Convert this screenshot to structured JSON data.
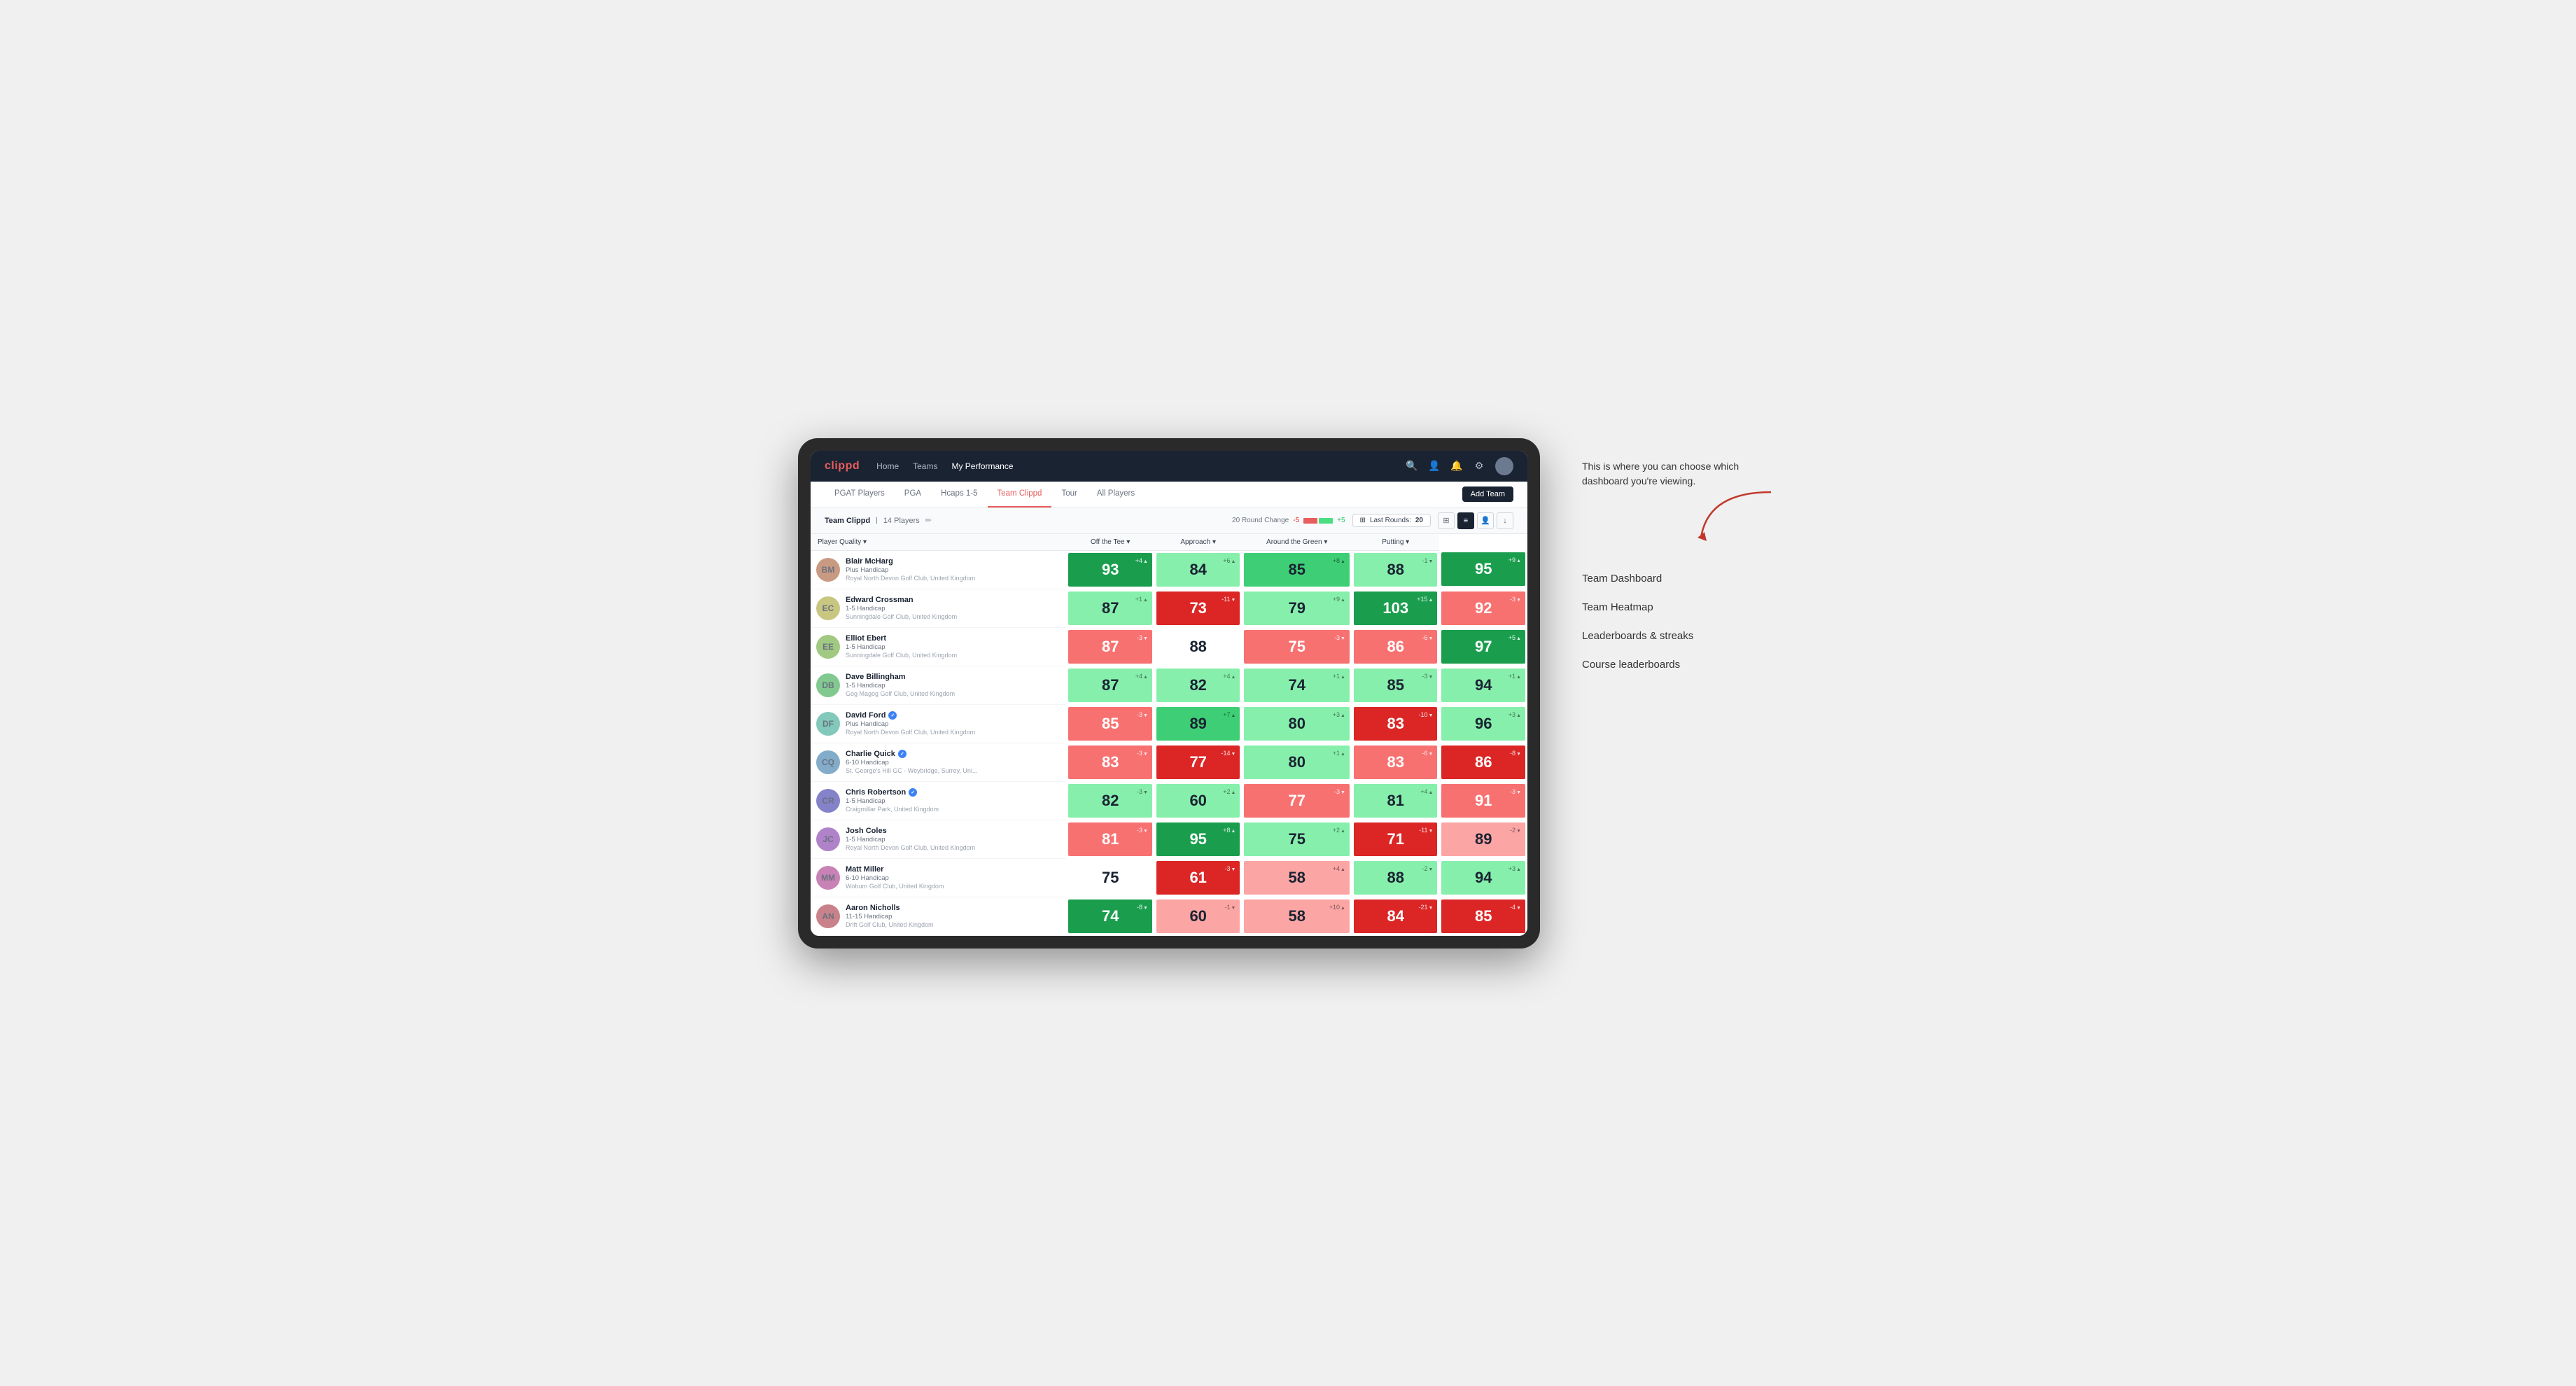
{
  "annotation": {
    "note": "This is where you can choose which dashboard you're viewing.",
    "arrow": "→",
    "items": [
      "Team Dashboard",
      "Team Heatmap",
      "Leaderboards & streaks",
      "Course leaderboards"
    ]
  },
  "nav": {
    "logo": "clippd",
    "links": [
      "Home",
      "Teams",
      "My Performance"
    ],
    "active_link": "My Performance"
  },
  "sub_tabs": [
    {
      "label": "PGAT Players",
      "active": false
    },
    {
      "label": "PGA",
      "active": false
    },
    {
      "label": "Hcaps 1-5",
      "active": false
    },
    {
      "label": "Team Clippd",
      "active": true
    },
    {
      "label": "Tour",
      "active": false
    },
    {
      "label": "All Players",
      "active": false
    }
  ],
  "add_team_btn": "Add Team",
  "team_bar": {
    "name": "Team Clippd",
    "count": "14 Players",
    "round_change_label": "20 Round Change",
    "neg_label": "-5",
    "pos_label": "+5",
    "last_rounds_label": "Last Rounds:",
    "last_rounds_value": "20"
  },
  "table": {
    "columns": [
      "Player Quality ▾",
      "Off the Tee ▾",
      "Approach ▾",
      "Around the Green ▾",
      "Putting ▾"
    ],
    "players": [
      {
        "name": "Blair McHarg",
        "handicap": "Plus Handicap",
        "club": "Royal North Devon Golf Club, United Kingdom",
        "verified": false,
        "initials": "BM",
        "scores": [
          {
            "value": 93,
            "change": "+4",
            "direction": "up",
            "color": "dark-green"
          },
          {
            "value": 84,
            "change": "+6",
            "direction": "up",
            "color": "light-green"
          },
          {
            "value": 85,
            "change": "+8",
            "direction": "up",
            "color": "mid-green"
          },
          {
            "value": 88,
            "change": "-1",
            "direction": "down",
            "color": "light-green"
          },
          {
            "value": 95,
            "change": "+9",
            "direction": "up",
            "color": "dark-green"
          }
        ]
      },
      {
        "name": "Edward Crossman",
        "handicap": "1-5 Handicap",
        "club": "Sunningdale Golf Club, United Kingdom",
        "verified": false,
        "initials": "EC",
        "scores": [
          {
            "value": 87,
            "change": "+1",
            "direction": "up",
            "color": "light-green"
          },
          {
            "value": 73,
            "change": "-11",
            "direction": "down",
            "color": "red"
          },
          {
            "value": 79,
            "change": "+9",
            "direction": "up",
            "color": "light-green"
          },
          {
            "value": 103,
            "change": "+15",
            "direction": "up",
            "color": "dark-green"
          },
          {
            "value": 92,
            "change": "-3",
            "direction": "down",
            "color": "mid-red"
          }
        ]
      },
      {
        "name": "Elliot Ebert",
        "handicap": "1-5 Handicap",
        "club": "Sunningdale Golf Club, United Kingdom",
        "verified": false,
        "initials": "EE",
        "scores": [
          {
            "value": 87,
            "change": "-3",
            "direction": "down",
            "color": "mid-red"
          },
          {
            "value": 88,
            "change": "",
            "direction": "",
            "color": "white"
          },
          {
            "value": 75,
            "change": "-3",
            "direction": "down",
            "color": "mid-red"
          },
          {
            "value": 86,
            "change": "-6",
            "direction": "down",
            "color": "mid-red"
          },
          {
            "value": 97,
            "change": "+5",
            "direction": "up",
            "color": "dark-green"
          }
        ]
      },
      {
        "name": "Dave Billingham",
        "handicap": "1-5 Handicap",
        "club": "Gog Magog Golf Club, United Kingdom",
        "verified": false,
        "initials": "DB",
        "scores": [
          {
            "value": 87,
            "change": "+4",
            "direction": "up",
            "color": "light-green"
          },
          {
            "value": 82,
            "change": "+4",
            "direction": "up",
            "color": "light-green"
          },
          {
            "value": 74,
            "change": "+1",
            "direction": "up",
            "color": "light-green"
          },
          {
            "value": 85,
            "change": "-3",
            "direction": "down",
            "color": "light-green"
          },
          {
            "value": 94,
            "change": "+1",
            "direction": "up",
            "color": "light-green"
          }
        ]
      },
      {
        "name": "David Ford",
        "handicap": "Plus Handicap",
        "club": "Royal North Devon Golf Club, United Kingdom",
        "verified": true,
        "initials": "DF",
        "scores": [
          {
            "value": 85,
            "change": "-3",
            "direction": "down",
            "color": "mid-red"
          },
          {
            "value": 89,
            "change": "+7",
            "direction": "up",
            "color": "mid-green"
          },
          {
            "value": 80,
            "change": "+3",
            "direction": "up",
            "color": "light-green"
          },
          {
            "value": 83,
            "change": "-10",
            "direction": "down",
            "color": "red"
          },
          {
            "value": 96,
            "change": "+3",
            "direction": "up",
            "color": "light-green"
          }
        ]
      },
      {
        "name": "Charlie Quick",
        "handicap": "6-10 Handicap",
        "club": "St. George's Hill GC - Weybridge, Surrey, Uni...",
        "verified": true,
        "initials": "CQ",
        "scores": [
          {
            "value": 83,
            "change": "-3",
            "direction": "down",
            "color": "mid-red"
          },
          {
            "value": 77,
            "change": "-14",
            "direction": "down",
            "color": "red"
          },
          {
            "value": 80,
            "change": "+1",
            "direction": "up",
            "color": "light-green"
          },
          {
            "value": 83,
            "change": "-6",
            "direction": "down",
            "color": "mid-red"
          },
          {
            "value": 86,
            "change": "-8",
            "direction": "down",
            "color": "red"
          }
        ]
      },
      {
        "name": "Chris Robertson",
        "handicap": "1-5 Handicap",
        "club": "Craigmillar Park, United Kingdom",
        "verified": true,
        "initials": "CR",
        "scores": [
          {
            "value": 82,
            "change": "-3",
            "direction": "down",
            "color": "light-green"
          },
          {
            "value": 60,
            "change": "+2",
            "direction": "up",
            "color": "light-green"
          },
          {
            "value": 77,
            "change": "-3",
            "direction": "down",
            "color": "mid-red"
          },
          {
            "value": 81,
            "change": "+4",
            "direction": "up",
            "color": "light-green"
          },
          {
            "value": 91,
            "change": "-3",
            "direction": "down",
            "color": "mid-red"
          }
        ]
      },
      {
        "name": "Josh Coles",
        "handicap": "1-5 Handicap",
        "club": "Royal North Devon Golf Club, United Kingdom",
        "verified": false,
        "initials": "JC",
        "scores": [
          {
            "value": 81,
            "change": "-3",
            "direction": "down",
            "color": "mid-red"
          },
          {
            "value": 95,
            "change": "+8",
            "direction": "up",
            "color": "dark-green"
          },
          {
            "value": 75,
            "change": "+2",
            "direction": "up",
            "color": "light-green"
          },
          {
            "value": 71,
            "change": "-11",
            "direction": "down",
            "color": "red"
          },
          {
            "value": 89,
            "change": "-2",
            "direction": "down",
            "color": "light-red"
          }
        ]
      },
      {
        "name": "Matt Miller",
        "handicap": "6-10 Handicap",
        "club": "Woburn Golf Club, United Kingdom",
        "verified": false,
        "initials": "MM",
        "scores": [
          {
            "value": 75,
            "change": "",
            "direction": "",
            "color": "white"
          },
          {
            "value": 61,
            "change": "-3",
            "direction": "down",
            "color": "red"
          },
          {
            "value": 58,
            "change": "+4",
            "direction": "up",
            "color": "light-red"
          },
          {
            "value": 88,
            "change": "-2",
            "direction": "down",
            "color": "light-green"
          },
          {
            "value": 94,
            "change": "+3",
            "direction": "up",
            "color": "light-green"
          }
        ]
      },
      {
        "name": "Aaron Nicholls",
        "handicap": "11-15 Handicap",
        "club": "Drift Golf Club, United Kingdom",
        "verified": false,
        "initials": "AN",
        "scores": [
          {
            "value": 74,
            "change": "-8",
            "direction": "down",
            "color": "dark-green"
          },
          {
            "value": 60,
            "change": "-1",
            "direction": "down",
            "color": "light-red"
          },
          {
            "value": 58,
            "change": "+10",
            "direction": "up",
            "color": "light-red"
          },
          {
            "value": 84,
            "change": "-21",
            "direction": "down",
            "color": "red"
          },
          {
            "value": 85,
            "change": "-4",
            "direction": "down",
            "color": "red"
          }
        ]
      }
    ]
  }
}
